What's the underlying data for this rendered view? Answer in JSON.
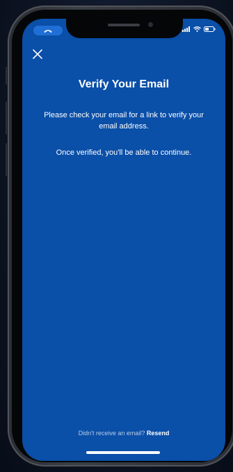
{
  "status_bar": {
    "call_icon": "phone-handset-icon",
    "signal_icon": "signal-icon",
    "wifi_icon": "wifi-icon",
    "battery_icon": "battery-icon"
  },
  "header": {
    "close_icon": "close-icon"
  },
  "main": {
    "title": "Verify Your Email",
    "message_line1": "Please check your email for a link to verify your email address.",
    "message_line2": "Once verified, you'll be able to continue."
  },
  "footer": {
    "prompt": "Didn't receive an email?",
    "resend_label": "Resend"
  },
  "colors": {
    "screen_background": "#0a4fa8",
    "text": "#ffffff",
    "call_pill": "#1f6fd6"
  }
}
